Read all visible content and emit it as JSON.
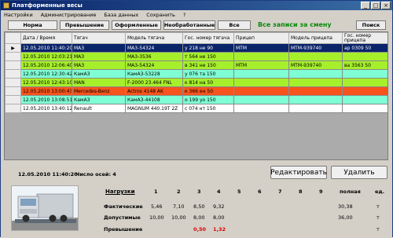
{
  "window": {
    "title": "Платформенные весы",
    "min": "_",
    "max": "□",
    "close": "×"
  },
  "menu": [
    "Настройки",
    "Администрирование",
    "База данных",
    "Сохранить",
    "?"
  ],
  "toolbar": {
    "filters": [
      "Норма",
      "Превышение",
      "Оформленные",
      "Необработанные",
      "Все"
    ],
    "status": "Все записи за смену",
    "search": "Поиск"
  },
  "grid": {
    "columns": [
      "Дата / Время",
      "Тягач",
      "Модель тягача",
      "Гос. номер тягача",
      "Прицеп",
      "Модель прицепа",
      "Гос. номер прицепа"
    ],
    "rows": [
      {
        "cells": [
          "12.05.2010 11:40:20",
          "МАЗ",
          "MA3-54324",
          "у 218 не 90",
          "МТМ",
          "МТМ-939740",
          "ар 0309 50"
        ],
        "bg": "#0a246a",
        "fg": "#ffffff",
        "marker": "▶"
      },
      {
        "cells": [
          "12.05.2010 12:03:21",
          "МАЗ",
          "МА3-3536",
          "т 564 не 150",
          "",
          "",
          ""
        ],
        "bg": "#a6ef2b",
        "fg": "#000000",
        "marker": ""
      },
      {
        "cells": [
          "12.05.2010 12:06:40",
          "МАЗ",
          "МА3-54324",
          "в 341 не 150",
          "МТМ",
          "МТМ-939740",
          "ва 3563 50"
        ],
        "bg": "#a6ef2b",
        "fg": "#000000",
        "marker": ""
      },
      {
        "cells": [
          "12.05.2010 12:30:42",
          "КамАЗ",
          "КамАЗ-53228",
          "у 076 та 150",
          "",
          "",
          ""
        ],
        "bg": "#7fffd4",
        "fg": "#000000",
        "marker": ""
      },
      {
        "cells": [
          "12.05.2010 12:43:10",
          "MAN",
          "F-2000 23.464 FNL",
          "к 814 на 50",
          "",
          "",
          ""
        ],
        "bg": "#a6ef2b",
        "fg": "#000000",
        "marker": ""
      },
      {
        "cells": [
          "12.05.2010 13:00:43",
          "Mercedes-Benz",
          "Actros 4148 AK",
          "к 366 ен 50",
          "",
          "",
          ""
        ],
        "bg": "#f6541c",
        "fg": "#000000",
        "marker": ""
      },
      {
        "cells": [
          "12.05.2010 13:08:51",
          "КамАЗ",
          "КамАЗ-44108",
          "о 199 уо 150",
          "",
          "",
          ""
        ],
        "bg": "#7fffd4",
        "fg": "#000000",
        "marker": ""
      },
      {
        "cells": [
          "12.05.2010 13:40:12",
          "Renault",
          "MAGNUM 440.19T 2Z",
          "с 074 нт 150",
          "",
          "",
          ""
        ],
        "bg": "#ffffff",
        "fg": "#000000",
        "marker": ""
      }
    ]
  },
  "details": {
    "datetime": "12.05.2010 11:40:20",
    "axles_label": "Число осей: 4",
    "edit_button": "Редактировать",
    "delete_button": "Удалить",
    "loads_label": "Нагрузки",
    "axle_numbers": [
      "1",
      "2",
      "3",
      "4",
      "5",
      "6",
      "7",
      "8",
      "9"
    ],
    "total_label": "полная",
    "unit_label": "ед.",
    "rows": [
      {
        "label": "Фактические",
        "values": [
          "5,46",
          "7,10",
          "8,50",
          "9,32",
          "",
          "",
          "",
          "",
          ""
        ],
        "total": "30,38",
        "unit": "т",
        "red": false
      },
      {
        "label": "Допустимые",
        "values": [
          "10,00",
          "10,00",
          "8,00",
          "8,00",
          "",
          "",
          "",
          "",
          ""
        ],
        "total": "36,00",
        "unit": "т",
        "red": false
      },
      {
        "label": "Превышение",
        "values": [
          "",
          "",
          "0,50",
          "1,32",
          "",
          "",
          "",
          "",
          ""
        ],
        "total": "",
        "unit": "т",
        "red": true
      }
    ]
  },
  "colors": {
    "selected": "#0a246a",
    "norm": "#a6ef2b",
    "formalized": "#7fffd4",
    "exceeded": "#f6541c",
    "status_green": "#0a8a0a",
    "exceed_red": "#e00000"
  },
  "icons": {
    "app": "scales-icon",
    "truck": "truck-on-scale-image"
  }
}
